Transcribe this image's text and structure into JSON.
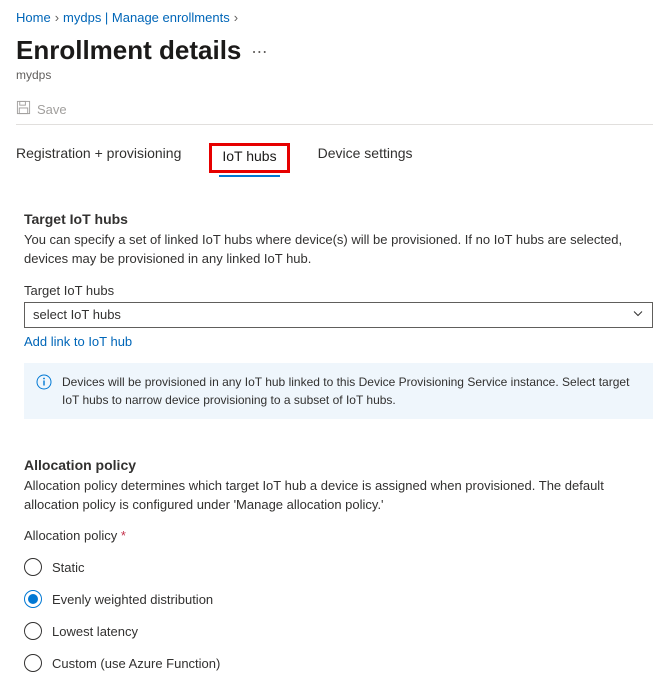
{
  "breadcrumb": {
    "home": "Home",
    "path1": "mydps | Manage enrollments"
  },
  "title": "Enrollment details",
  "subtitle": "mydps",
  "toolbar": {
    "save": "Save"
  },
  "tabs": {
    "reg": "Registration + provisioning",
    "iot": "IoT hubs",
    "dev": "Device settings"
  },
  "targetHubs": {
    "heading": "Target IoT hubs",
    "desc": "You can specify a set of linked IoT hubs where device(s) will be provisioned. If no IoT hubs are selected, devices may be provisioned in any linked IoT hub.",
    "fieldLabel": "Target IoT hubs",
    "placeholder": "select IoT hubs",
    "addLink": "Add link to IoT hub",
    "info": "Devices will be provisioned in any IoT hub linked to this Device Provisioning Service instance. Select target IoT hubs to narrow device provisioning to a subset of IoT hubs."
  },
  "allocation": {
    "heading": "Allocation policy",
    "desc": "Allocation policy determines which target IoT hub a device is assigned when provisioned. The default allocation policy is configured under 'Manage allocation policy.'",
    "fieldLabel": "Allocation policy",
    "options": {
      "static": "Static",
      "even": "Evenly weighted distribution",
      "lowest": "Lowest latency",
      "custom": "Custom (use Azure Function)"
    },
    "selected": "even"
  }
}
